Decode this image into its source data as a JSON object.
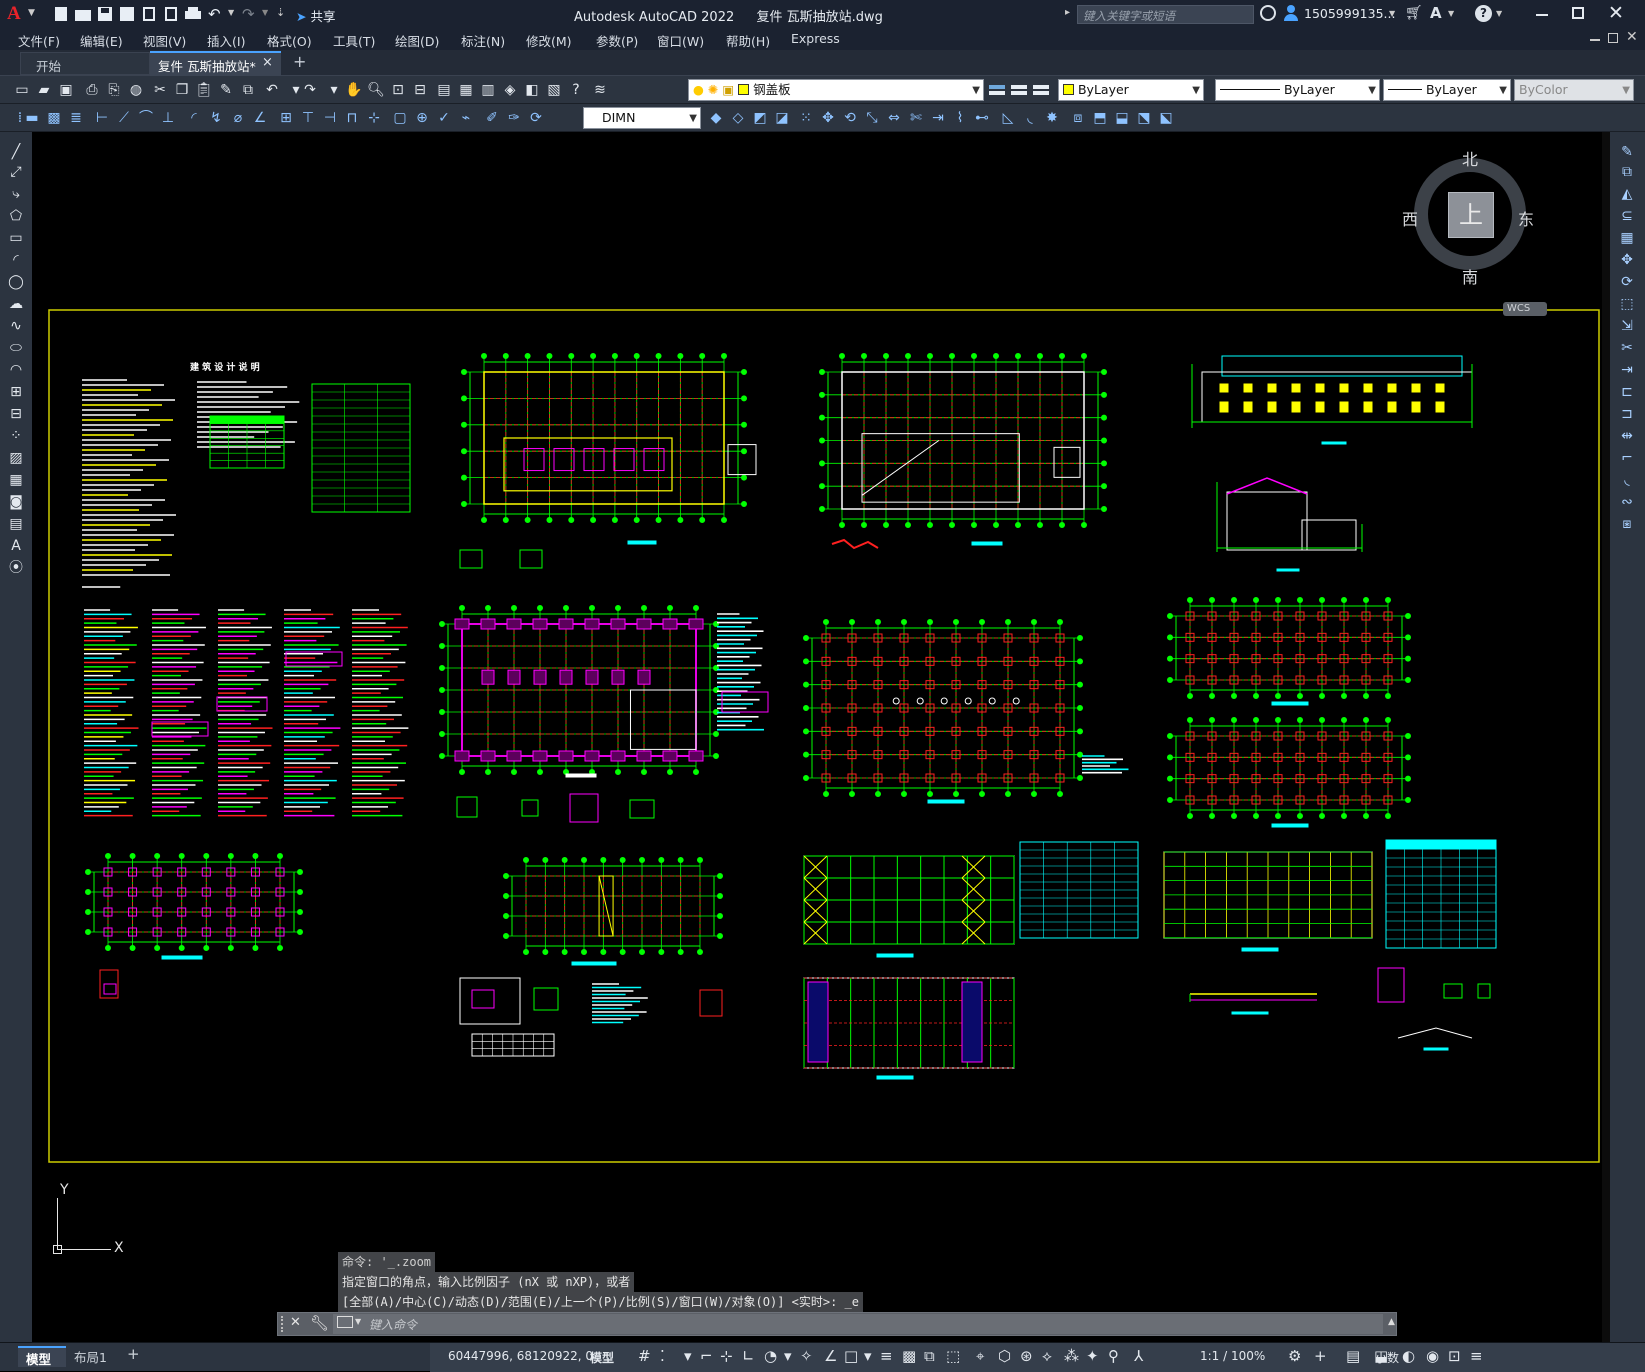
{
  "title": {
    "app_title": "Autodesk AutoCAD 2022",
    "file_name": "复件 瓦斯抽放站.dwg",
    "search_placeholder": "键入关键字或短语",
    "user": "1505999135...",
    "share_label": "共享"
  },
  "menu": [
    {
      "label": "文件(F)"
    },
    {
      "label": "编辑(E)"
    },
    {
      "label": "视图(V)"
    },
    {
      "label": "插入(I)"
    },
    {
      "label": "格式(O)"
    },
    {
      "label": "工具(T)"
    },
    {
      "label": "绘图(D)"
    },
    {
      "label": "标注(N)"
    },
    {
      "label": "修改(M)"
    },
    {
      "label": "参数(P)"
    },
    {
      "label": "窗口(W)"
    },
    {
      "label": "帮助(H)"
    },
    {
      "label": "Express"
    }
  ],
  "tabs": {
    "start": "开始",
    "active": "复件 瓦斯抽放站*",
    "close": "×",
    "add": "+"
  },
  "toolbar": {
    "layer_value": "钢盖板",
    "color_value": "ByLayer",
    "linetype_value": "ByLayer",
    "lineweight_value": "ByLayer",
    "plotstyle_value": "ByColor",
    "dimstyle_value": "DIMN"
  },
  "viewcube": {
    "north": "北",
    "south": "南",
    "east": "东",
    "west": "西",
    "face": "上",
    "wcs": "WCS"
  },
  "drawing": {
    "title_text": "建 筑 设 计 说 明"
  },
  "ucs": {
    "x": "X",
    "y": "Y"
  },
  "command": {
    "history": [
      "命令: '_.zoom",
      "指定窗口的角点，输入比例因子 (nX 或 nXP)，或者",
      "[全部(A)/中心(C)/动态(D)/范围(E)/上一个(P)/比例(S)/窗口(W)/对象(O)] <实时>: _e"
    ],
    "placeholder": "键入命令"
  },
  "status": {
    "layout_tabs": [
      "模型",
      "布局1"
    ],
    "add": "+",
    "coords": "60447996, 68120922, 0",
    "model_label": "模型",
    "scale": "1:1 / 100%",
    "units": "小数"
  },
  "colors": {
    "green": "#00ff00",
    "red": "#ff2020",
    "yellow": "#ffff00",
    "cyan": "#00ffff",
    "magenta": "#ff00ff",
    "white": "#ffffff",
    "border": "#cccc00"
  }
}
